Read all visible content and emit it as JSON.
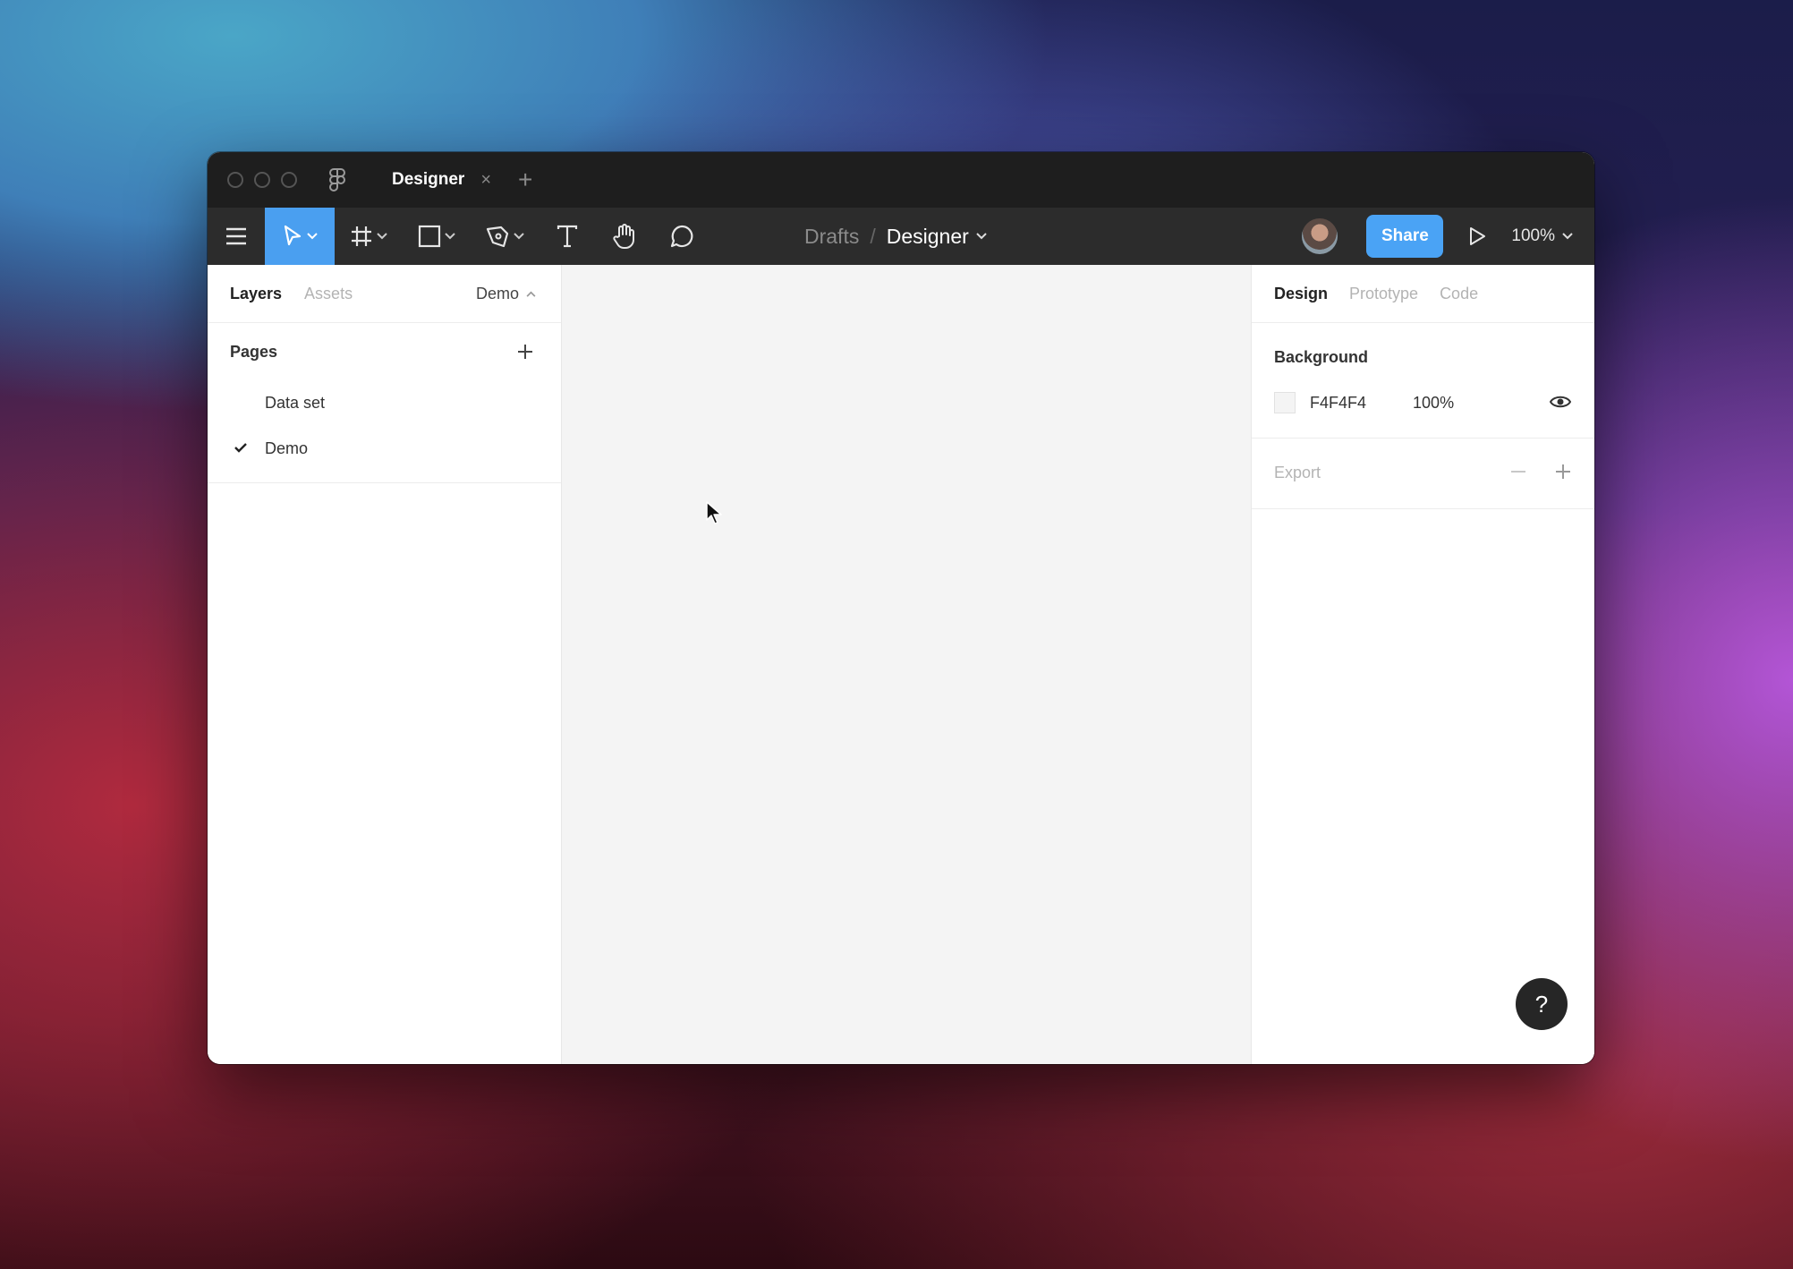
{
  "window": {
    "tab_title": "Designer",
    "tab_close": "×",
    "new_tab": "+"
  },
  "toolbar": {
    "breadcrumb_parent": "Drafts",
    "breadcrumb_separator": "/",
    "breadcrumb_current": "Designer",
    "share_label": "Share",
    "zoom_label": "100%",
    "accent_color": "#4a9ff0",
    "tools": [
      "menu-icon",
      "move-tool-icon",
      "frame-tool-icon",
      "rectangle-tool-icon",
      "pen-tool-icon",
      "text-tool-icon",
      "hand-tool-icon",
      "comment-tool-icon"
    ]
  },
  "left_panel": {
    "tab_layers": "Layers",
    "tab_assets": "Assets",
    "current_page": "Demo",
    "pages_heading": "Pages",
    "pages": [
      {
        "label": "Data set",
        "selected": false
      },
      {
        "label": "Demo",
        "selected": true
      }
    ]
  },
  "right_panel": {
    "tab_design": "Design",
    "tab_prototype": "Prototype",
    "tab_code": "Code",
    "background_title": "Background",
    "background_hex": "F4F4F4",
    "background_opacity": "100%",
    "background_color": "#F4F4F4",
    "export_title": "Export"
  },
  "help_label": "?"
}
